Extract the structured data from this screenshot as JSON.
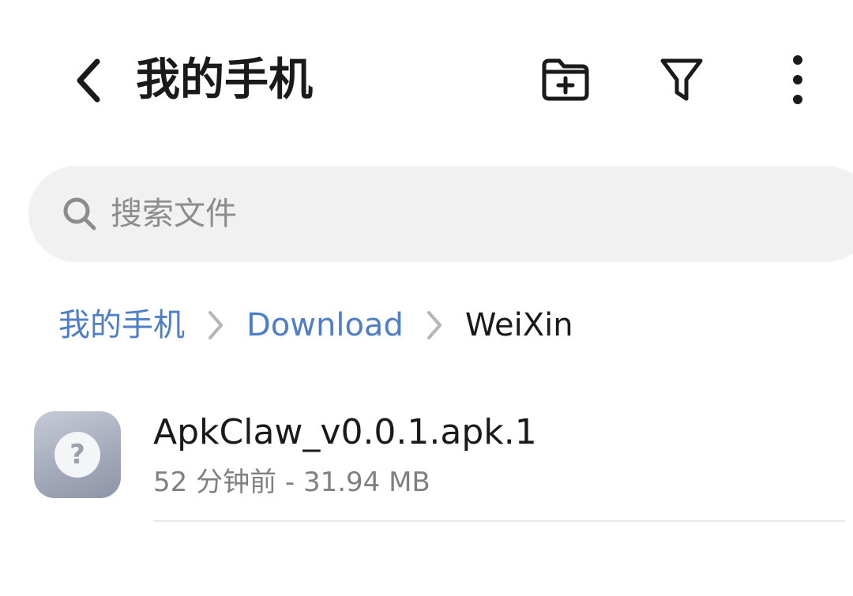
{
  "header": {
    "title": "我的手机",
    "back_icon": "chevron-left-icon",
    "actions": [
      "new-folder-icon",
      "filter-icon",
      "more-vertical-icon"
    ]
  },
  "search": {
    "placeholder": "搜索文件",
    "value": ""
  },
  "breadcrumb": {
    "items": [
      {
        "label": "我的手机",
        "state": "link"
      },
      {
        "label": "Download",
        "state": "link"
      },
      {
        "label": "WeiXin",
        "state": "current"
      }
    ]
  },
  "files": [
    {
      "name": "ApkClaw_v0.0.1.apk.1",
      "meta": "52 分钟前 - 31.94 MB",
      "icon": "unknown-file-icon",
      "icon_glyph": "?"
    }
  ],
  "colors": {
    "text": "#1a1a1a",
    "link": "#4e7ec8",
    "secondary_text": "#808080",
    "search_bg": "#f1f1f1",
    "divider": "#e8e8e8"
  }
}
